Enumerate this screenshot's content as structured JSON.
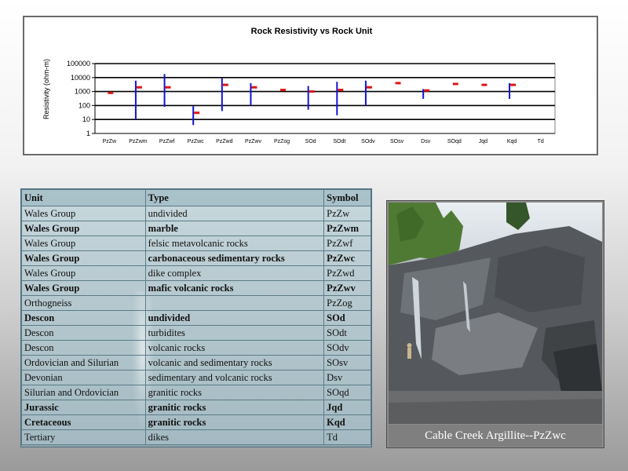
{
  "chart_data": {
    "type": "scatter",
    "title": "Rock Resistivity vs Rock Unit",
    "ylabel": "Resistivity (ohm-m)",
    "xlabel": "",
    "y_scale": "log",
    "ylim": [
      1,
      100000
    ],
    "y_ticks": [
      "1",
      "10",
      "100",
      "1000",
      "10000",
      "100000"
    ],
    "grid": true,
    "categories": [
      "PzZw",
      "PzZwm",
      "PzZwf",
      "PzZwc",
      "PzZwd",
      "PzZwv",
      "PzZog",
      "SOd",
      "SOdt",
      "SOdv",
      "SOsv",
      "Dsv",
      "SOqd",
      "Jqd",
      "Kqd",
      "Td"
    ],
    "series": [
      {
        "name": "",
        "color": "#1414d2",
        "ranges": [
          null,
          [
            10,
            6000
          ],
          [
            80,
            18000
          ],
          [
            4,
            90
          ],
          [
            40,
            9000
          ],
          [
            100,
            4000
          ],
          null,
          [
            50,
            2500
          ],
          [
            20,
            5000
          ],
          [
            100,
            6000
          ],
          null,
          [
            300,
            1500
          ],
          null,
          null,
          [
            300,
            4000
          ],
          null
        ]
      },
      {
        "name": "",
        "color": "#e01414",
        "values": [
          800,
          2000,
          2000,
          30,
          3000,
          2000,
          1300,
          1000,
          1300,
          2000,
          4000,
          1200,
          3500,
          3000,
          3000,
          null
        ]
      }
    ]
  },
  "table": {
    "headers": [
      "Unit",
      "Type",
      "Symbol"
    ],
    "rows": [
      [
        "Wales Group",
        "undivided",
        "PzZw"
      ],
      [
        "Wales Group",
        "marble",
        "PzZwm"
      ],
      [
        "Wales Group",
        "felsic metavolcanic rocks",
        "PzZwf"
      ],
      [
        "Wales Group",
        "carbonaceous sedimentary rocks",
        "PzZwc"
      ],
      [
        "Wales Group",
        "dike complex",
        "PzZwd"
      ],
      [
        "Wales Group",
        "mafic volcanic rocks",
        "PzZwv"
      ],
      [
        "Orthogneiss",
        "",
        "PzZog"
      ],
      [
        "Descon",
        "undivided",
        "SOd"
      ],
      [
        "Descon",
        "turbidites",
        "SOdt"
      ],
      [
        "Descon",
        "volcanic rocks",
        "SOdv"
      ],
      [
        "Ordovician and Silurian",
        "volcanic and sedimentary rocks",
        "SOsv"
      ],
      [
        "Devonian",
        "sedimentary and volcanic rocks",
        "Dsv"
      ],
      [
        "Silurian and Ordovician",
        "granitic rocks",
        "SOqd"
      ],
      [
        "Jurassic",
        "granitic rocks",
        "Jqd"
      ],
      [
        "Cretaceous",
        "granitic rocks",
        "Kqd"
      ],
      [
        "Tertiary",
        "dikes",
        "Td"
      ]
    ],
    "bold_rows": [
      1,
      3,
      5,
      7,
      13,
      14
    ]
  },
  "photo": {
    "caption": "Cable Creek Argillite--PzZwc"
  }
}
